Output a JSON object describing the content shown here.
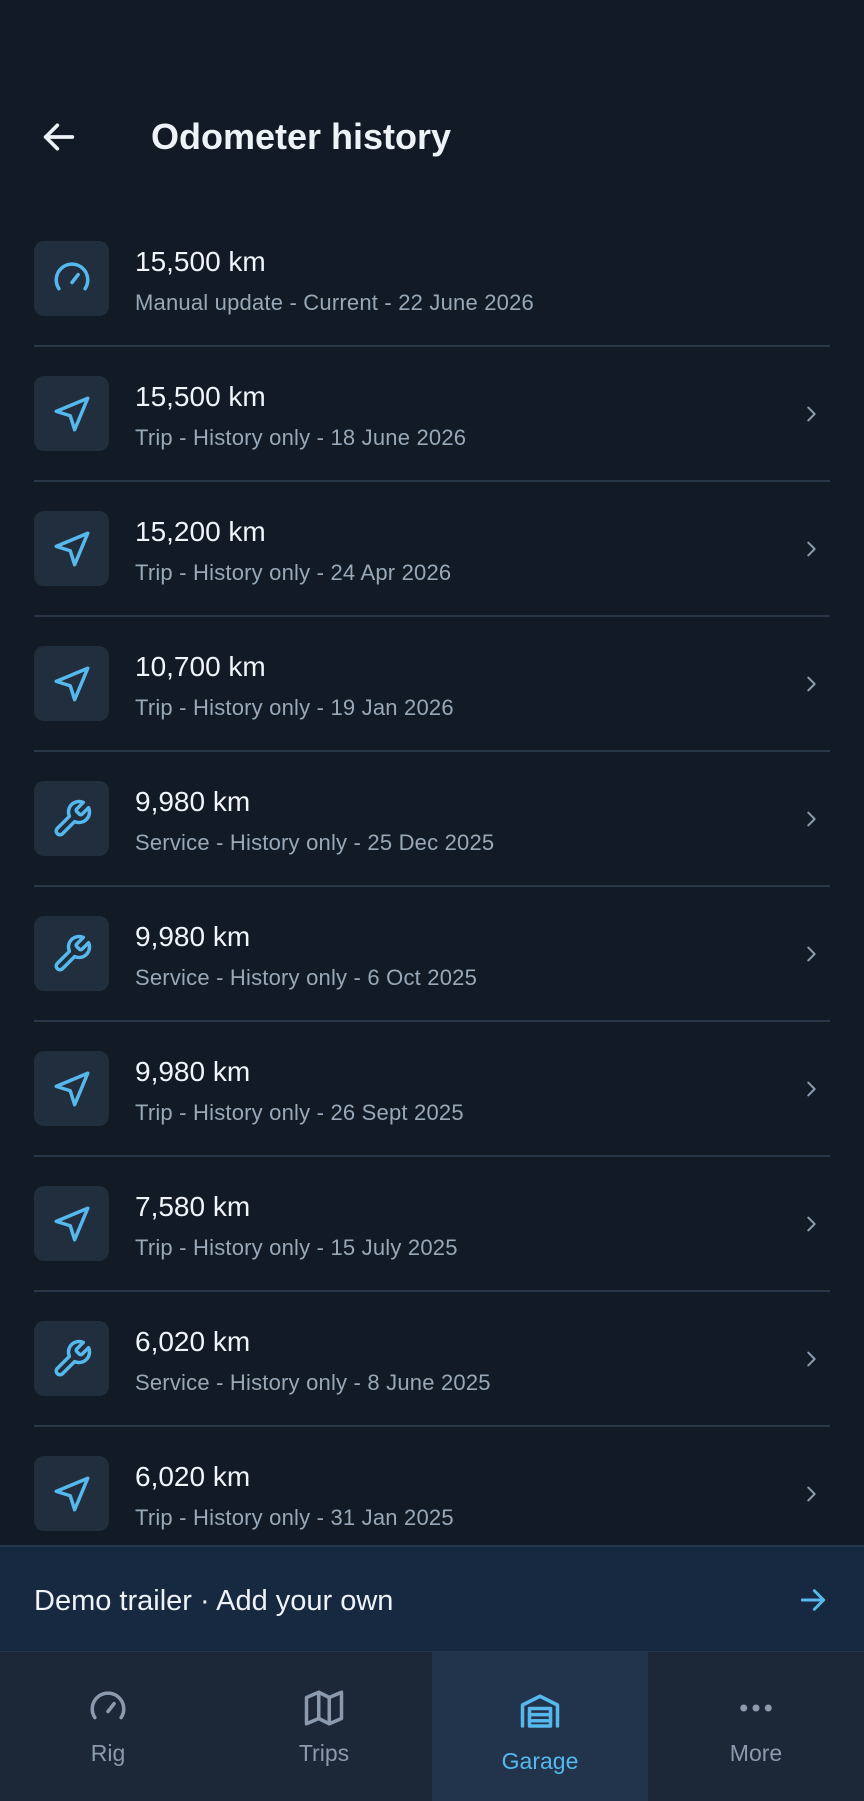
{
  "header": {
    "title": "Odometer history",
    "back_icon": "arrow-left-icon"
  },
  "entries": [
    {
      "value": "15,500 km",
      "subtitle": "Manual update - Current - 22 June 2026",
      "icon": "speedometer-icon",
      "has_chevron": false
    },
    {
      "value": "15,500 km",
      "subtitle": "Trip - History only - 18 June 2026",
      "icon": "navigation-icon",
      "has_chevron": true
    },
    {
      "value": "15,200 km",
      "subtitle": "Trip - History only - 24 Apr 2026",
      "icon": "navigation-icon",
      "has_chevron": true
    },
    {
      "value": "10,700 km",
      "subtitle": "Trip - History only - 19 Jan 2026",
      "icon": "navigation-icon",
      "has_chevron": true
    },
    {
      "value": "9,980 km",
      "subtitle": "Service - History only - 25 Dec 2025",
      "icon": "wrench-icon",
      "has_chevron": true
    },
    {
      "value": "9,980 km",
      "subtitle": "Service - History only - 6 Oct 2025",
      "icon": "wrench-icon",
      "has_chevron": true
    },
    {
      "value": "9,980 km",
      "subtitle": "Trip - History only - 26 Sept 2025",
      "icon": "navigation-icon",
      "has_chevron": true
    },
    {
      "value": "7,580 km",
      "subtitle": "Trip - History only - 15 July 2025",
      "icon": "navigation-icon",
      "has_chevron": true
    },
    {
      "value": "6,020 km",
      "subtitle": "Service - History only - 8 June 2025",
      "icon": "wrench-icon",
      "has_chevron": true
    },
    {
      "value": "6,020 km",
      "subtitle": "Trip - History only - 31 Jan 2025",
      "icon": "navigation-icon",
      "has_chevron": true
    }
  ],
  "banner": {
    "text": "Demo trailer · Add your own",
    "icon": "arrow-right-icon"
  },
  "tabs": [
    {
      "label": "Rig",
      "icon": "speedometer-icon",
      "active": false
    },
    {
      "label": "Trips",
      "icon": "map-icon",
      "active": false
    },
    {
      "label": "Garage",
      "icon": "garage-icon",
      "active": true
    },
    {
      "label": "More",
      "icon": "more-dots-icon",
      "active": false
    }
  ],
  "colors": {
    "background": "#111a25",
    "accent": "#56b8ec",
    "tile": "#212e3d",
    "divider": "#283647",
    "muted_text": "#98a8b9"
  }
}
